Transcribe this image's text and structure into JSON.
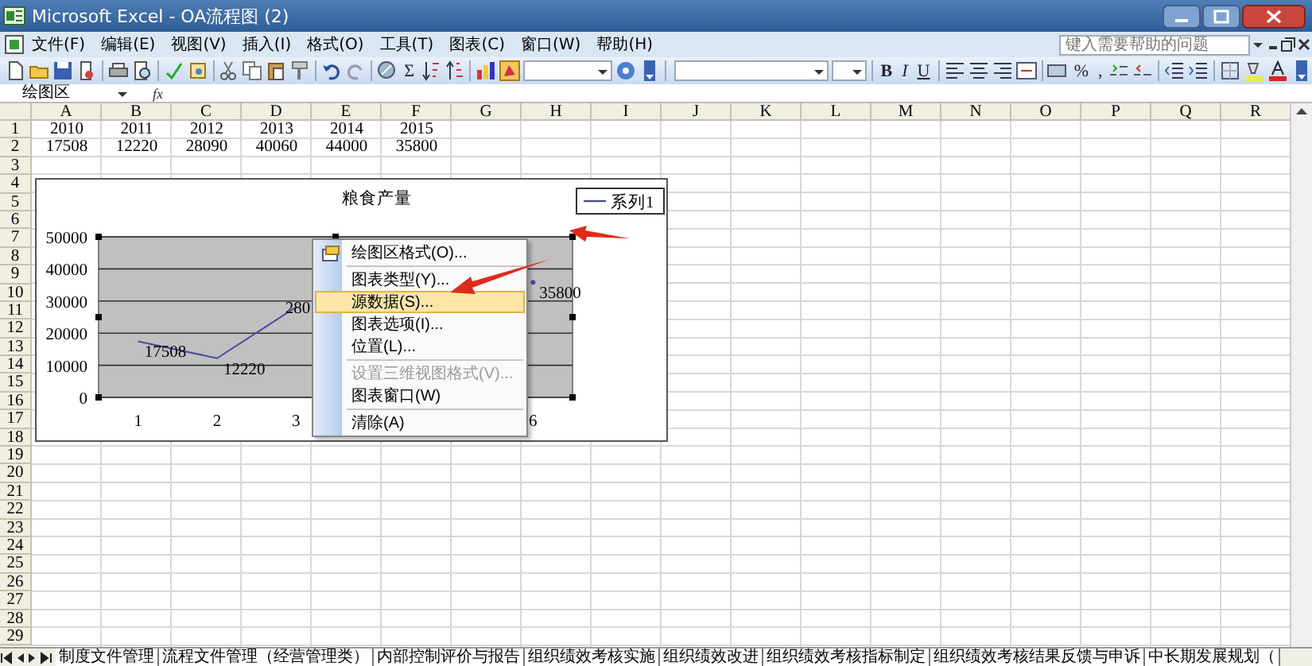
{
  "window": {
    "title": "Microsoft Excel - OA流程图 (2)"
  },
  "menu_bar": [
    "文件(F)",
    "编辑(E)",
    "视图(V)",
    "插入(I)",
    "格式(O)",
    "工具(T)",
    "图表(C)",
    "窗口(W)",
    "帮助(H)"
  ],
  "help_box": {
    "placeholder": "键入需要帮助的问题"
  },
  "standard_toolbar": {
    "autosum": "Σ"
  },
  "formatting_toolbar": {
    "bold": "B",
    "italic": "I",
    "underline": "U",
    "percent": "%",
    "comma": ","
  },
  "formula_bar": {
    "name_box": "绘图区",
    "fx": "fx"
  },
  "sheet": {
    "columns": [
      "A",
      "B",
      "C",
      "D",
      "E",
      "F",
      "G",
      "H",
      "I",
      "J",
      "K",
      "L",
      "M",
      "N",
      "O",
      "P",
      "Q",
      "R"
    ],
    "rows": [
      {
        "number": "1",
        "cells": [
          "2010",
          "2011",
          "2012",
          "2013",
          "2014",
          "2015"
        ]
      },
      {
        "number": "2",
        "cells": [
          "17508",
          "12220",
          "28090",
          "40060",
          "44000",
          "35800"
        ]
      },
      {
        "number": "3"
      },
      {
        "number": "4"
      },
      {
        "number": "5"
      },
      {
        "number": "6"
      },
      {
        "number": "7"
      },
      {
        "number": "8"
      },
      {
        "number": "9"
      },
      {
        "number": "10"
      },
      {
        "number": "11"
      },
      {
        "number": "12"
      },
      {
        "number": "13"
      },
      {
        "number": "14"
      },
      {
        "number": "15"
      },
      {
        "number": "16"
      },
      {
        "number": "17"
      },
      {
        "number": "18"
      },
      {
        "number": "19"
      },
      {
        "number": "20"
      },
      {
        "number": "21"
      },
      {
        "number": "22"
      },
      {
        "number": "23"
      },
      {
        "number": "24"
      },
      {
        "number": "25"
      },
      {
        "number": "26"
      },
      {
        "number": "27"
      },
      {
        "number": "28"
      },
      {
        "number": "29"
      }
    ]
  },
  "chart": {
    "chart_data": {
      "type": "line",
      "title": "粮食产量",
      "grid": true,
      "categories": [
        "1",
        "2",
        "3",
        null,
        null,
        "6"
      ],
      "series": [
        {
          "name": "系列1",
          "color": "#4a4a9a",
          "values": [
            17500,
            12200,
            28100,
            null,
            null,
            35800
          ]
        }
      ],
      "ylim": [
        0,
        50000
      ],
      "yticks": [
        0,
        10000,
        20000,
        30000,
        40000,
        50000
      ],
      "value_labels": [
        "17508",
        "12220",
        "280",
        null,
        null,
        "35800"
      ]
    }
  },
  "context_menu": [
    {
      "kind": "item",
      "label": "绘图区格式(O)...",
      "icon": true,
      "selected": false,
      "disabled": false
    },
    {
      "kind": "separator"
    },
    {
      "kind": "item",
      "label": "图表类型(Y)...",
      "icon": false,
      "selected": false,
      "disabled": false
    },
    {
      "kind": "item",
      "label": "源数据(S)...",
      "icon": false,
      "selected": true,
      "disabled": false
    },
    {
      "kind": "item",
      "label": "图表选项(I)...",
      "icon": false,
      "selected": false,
      "disabled": false
    },
    {
      "kind": "item",
      "label": "位置(L)...",
      "icon": false,
      "selected": false,
      "disabled": false
    },
    {
      "kind": "separator"
    },
    {
      "kind": "item",
      "label": "设置三维视图格式(V)...",
      "icon": false,
      "selected": false,
      "disabled": true
    },
    {
      "kind": "item",
      "label": "图表窗口(W)",
      "icon": false,
      "selected": false,
      "disabled": false
    },
    {
      "kind": "separator"
    },
    {
      "kind": "item",
      "label": "清除(A)",
      "icon": false,
      "selected": false,
      "disabled": false
    }
  ],
  "sheet_tabs": [
    {
      "label": "制度文件管理",
      "selected": false
    },
    {
      "label": "流程文件管理（经营管理类）",
      "selected": false
    },
    {
      "label": "内部控制评价与报告",
      "selected": false
    },
    {
      "label": "组织绩效考核实施",
      "selected": false
    },
    {
      "label": "组织绩效改进",
      "selected": false
    },
    {
      "label": "组织绩效考核指标制定",
      "selected": false
    },
    {
      "label": "组织绩效考核结果反馈与申诉",
      "selected": false
    },
    {
      "label": "中长期发展规划（",
      "selected": false
    }
  ]
}
